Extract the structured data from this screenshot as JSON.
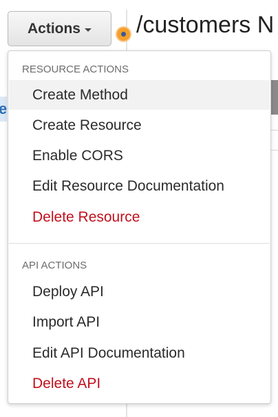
{
  "header": {
    "actions_label": "Actions",
    "resource_path": "/customers N"
  },
  "dropdown": {
    "sections": [
      {
        "title": "RESOURCE ACTIONS",
        "items": [
          {
            "label": "Create Method",
            "danger": false
          },
          {
            "label": "Create Resource",
            "danger": false
          },
          {
            "label": "Enable CORS",
            "danger": false
          },
          {
            "label": "Edit Resource Documentation",
            "danger": false
          },
          {
            "label": "Delete Resource",
            "danger": true
          }
        ]
      },
      {
        "title": "API ACTIONS",
        "items": [
          {
            "label": "Deploy API",
            "danger": false
          },
          {
            "label": "Import API",
            "danger": false
          },
          {
            "label": "Edit API Documentation",
            "danger": false
          },
          {
            "label": "Delete API",
            "danger": true
          }
        ]
      }
    ]
  },
  "background": {
    "left_clipped_text": "e"
  },
  "colors": {
    "danger": "#c0111d",
    "section_title": "#6c6c6c",
    "hover_bg": "#f2f2f2",
    "resource_dot": "#f59f2a"
  }
}
